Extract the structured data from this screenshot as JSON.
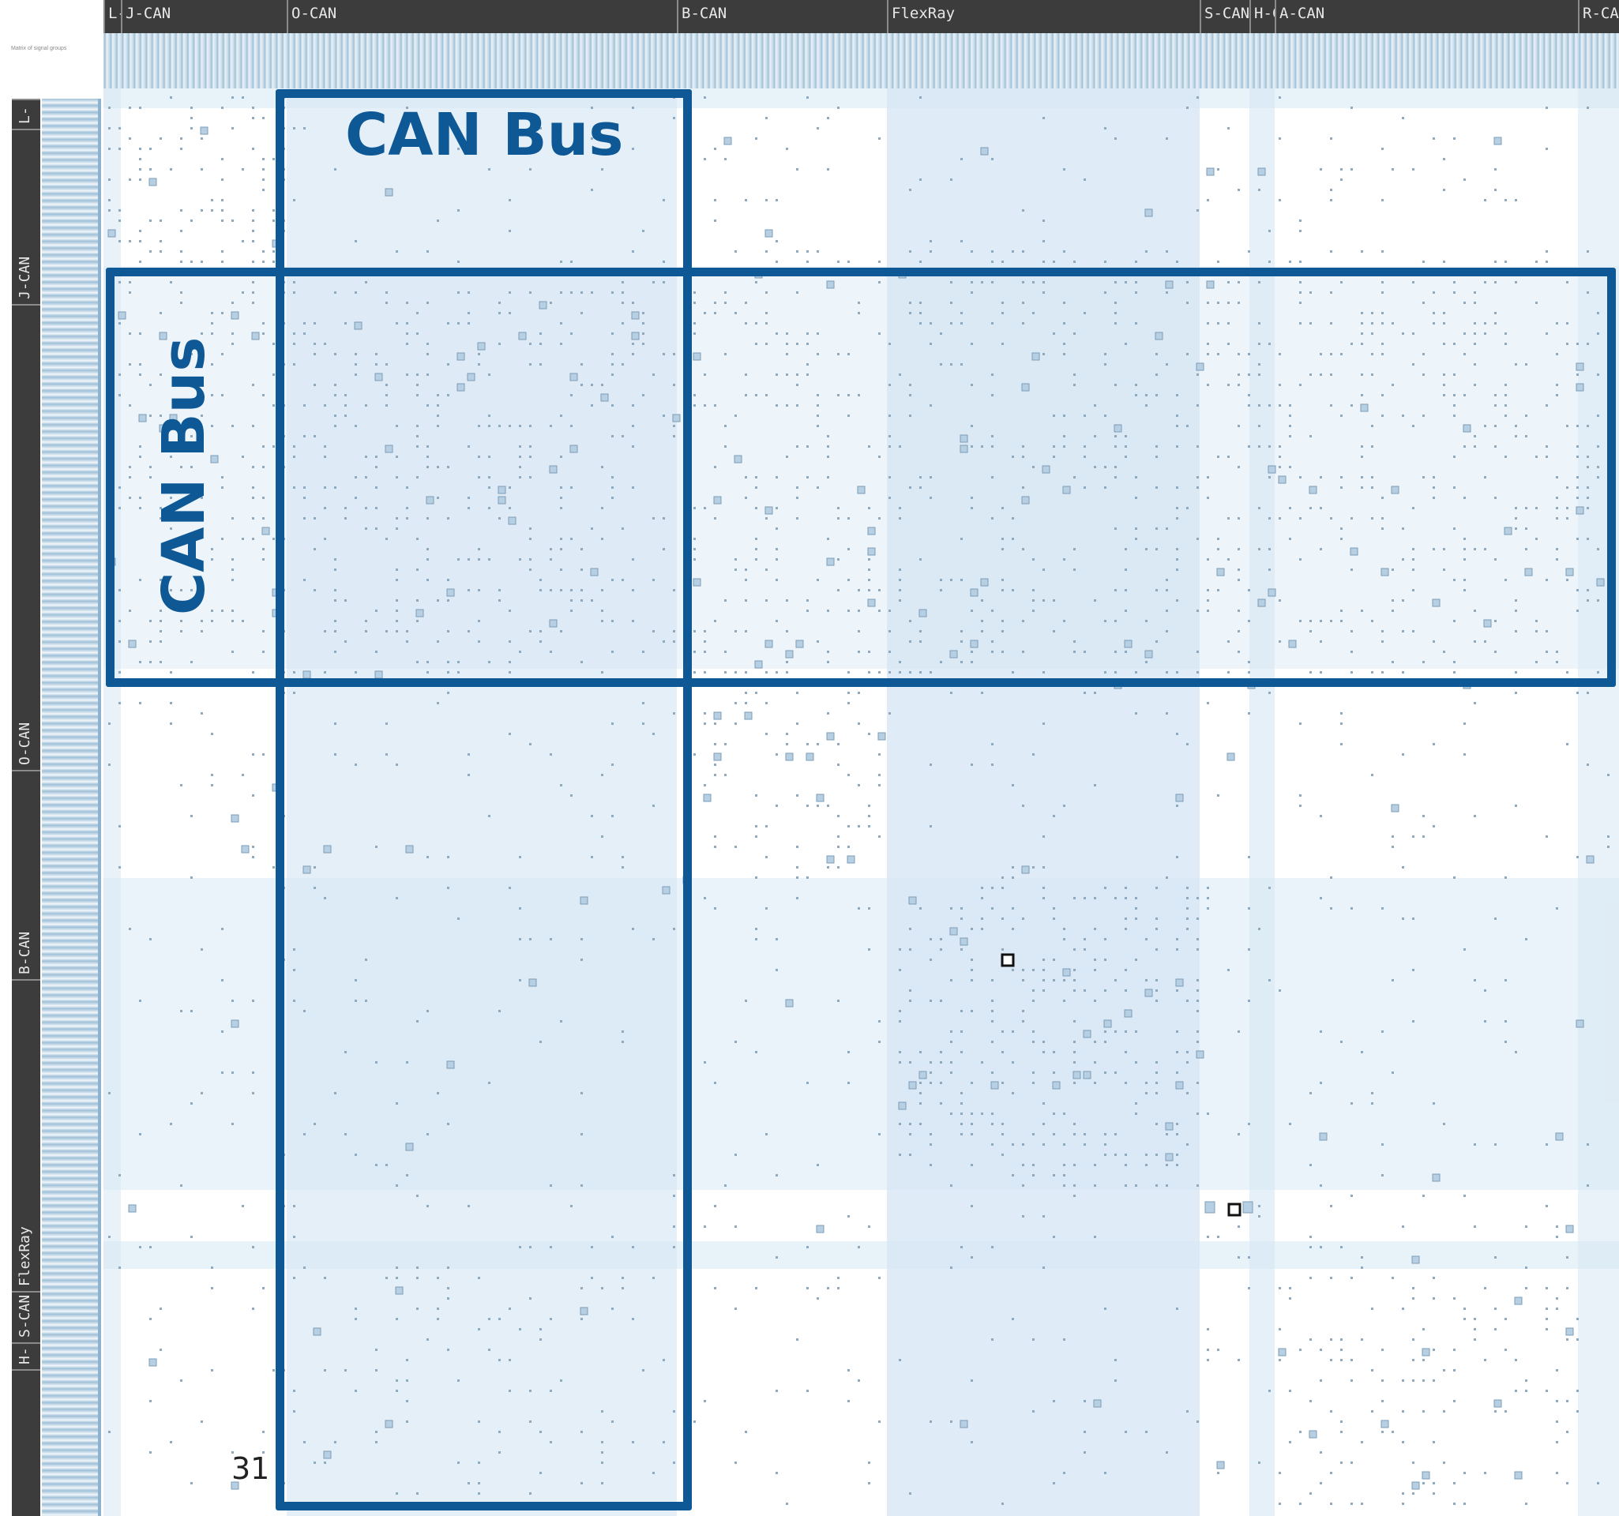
{
  "corner_note": "Matrix of signal groups",
  "column_buses": [
    "L-C",
    "J-CAN",
    "O-CAN",
    "B-CAN",
    "FlexRay",
    "S-CAN",
    "H-C",
    "A-CAN",
    "R-CA"
  ],
  "row_buses": [
    "L-",
    "J-CAN",
    "O-CAN",
    "B-CAN",
    "FlexRay",
    "S-CAN",
    "H-"
  ],
  "annotations": {
    "column_label": "CAN Bus",
    "row_label": "CAN Bus"
  },
  "slide_number": "31",
  "colors": {
    "frame": "#0e5896",
    "header_bg": "#3c3c3c",
    "cell": "#8fa9bf",
    "highlight_band": "#d6e7f4"
  },
  "icons": [
    "selected-cell-marker"
  ]
}
